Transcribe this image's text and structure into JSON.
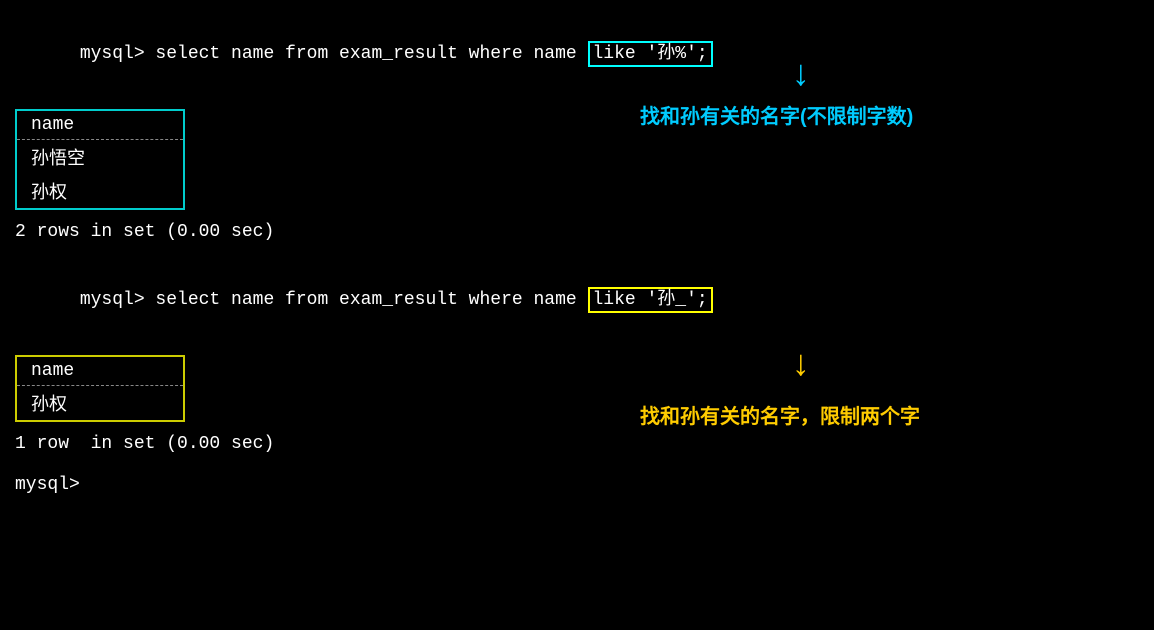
{
  "terminal": {
    "bg": "#000000",
    "sections": [
      {
        "id": "query1",
        "prompt": "mysql> select name from exam_result where name ",
        "highlight": "like '孙%';",
        "highlight_color": "cyan",
        "table_header": "name",
        "table_rows": [
          "孙悟空",
          "孙权"
        ],
        "result_text": "2 rows in set (0.00 sec)",
        "annotation": "找和孙有关的名字(不限制字数)",
        "annotation_color": "cyan"
      },
      {
        "id": "query2",
        "prompt": "mysql> select name from exam_result where name ",
        "highlight": "like '孙_';",
        "highlight_color": "yellow",
        "table_header": "name",
        "table_rows": [
          "孙权"
        ],
        "result_text": "1 row  in set (0.00 sec)",
        "annotation": "找和孙有关的名字，限制两个字",
        "annotation_color": "yellow"
      }
    ],
    "final_prompt": "mysql> "
  }
}
